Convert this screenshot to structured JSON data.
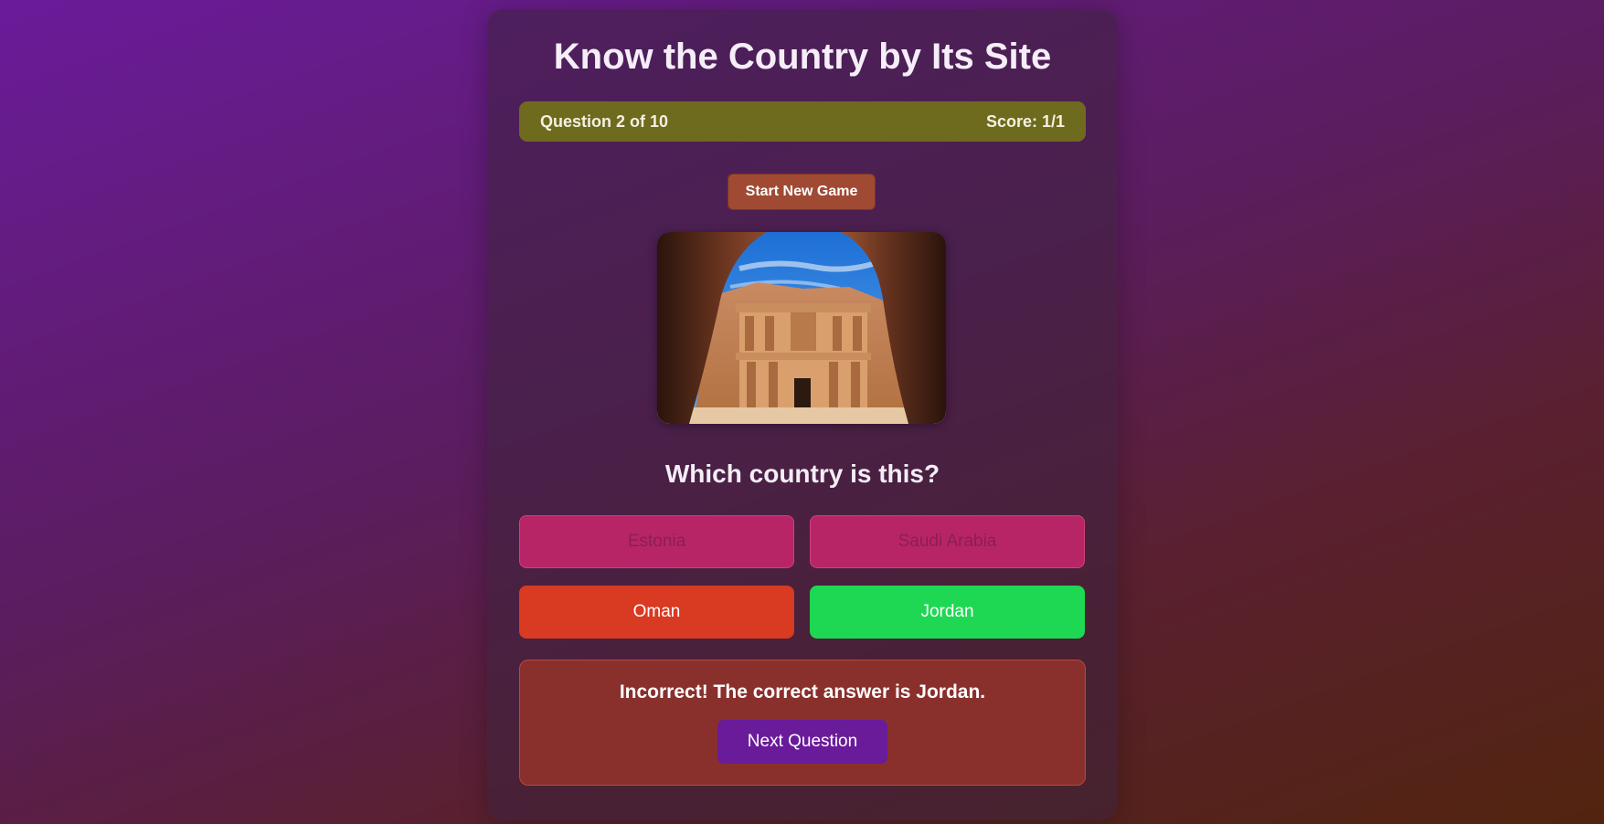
{
  "app": {
    "title": "Know the Country by Its Site"
  },
  "progress": {
    "label": "Question 2 of 10",
    "current": 2,
    "total": 10,
    "score_label": "Score: 1/1"
  },
  "controls": {
    "new_game_label": "Start New Game"
  },
  "image": {
    "subject": "rock-cut-monastery-through-cave"
  },
  "question": {
    "text": "Which country is this?"
  },
  "answers": [
    {
      "label": "Estonia",
      "state": "disabled"
    },
    {
      "label": "Saudi Arabia",
      "state": "disabled"
    },
    {
      "label": "Oman",
      "state": "selected-incorrect"
    },
    {
      "label": "Jordan",
      "state": "correct"
    }
  ],
  "feedback": {
    "message": "Incorrect! The correct answer is Jordan.",
    "next_label": "Next Question"
  },
  "colors": {
    "correct": "#1ed853",
    "incorrect": "#d93a22",
    "option": "#b82566",
    "accent": "#6a1b9a"
  }
}
